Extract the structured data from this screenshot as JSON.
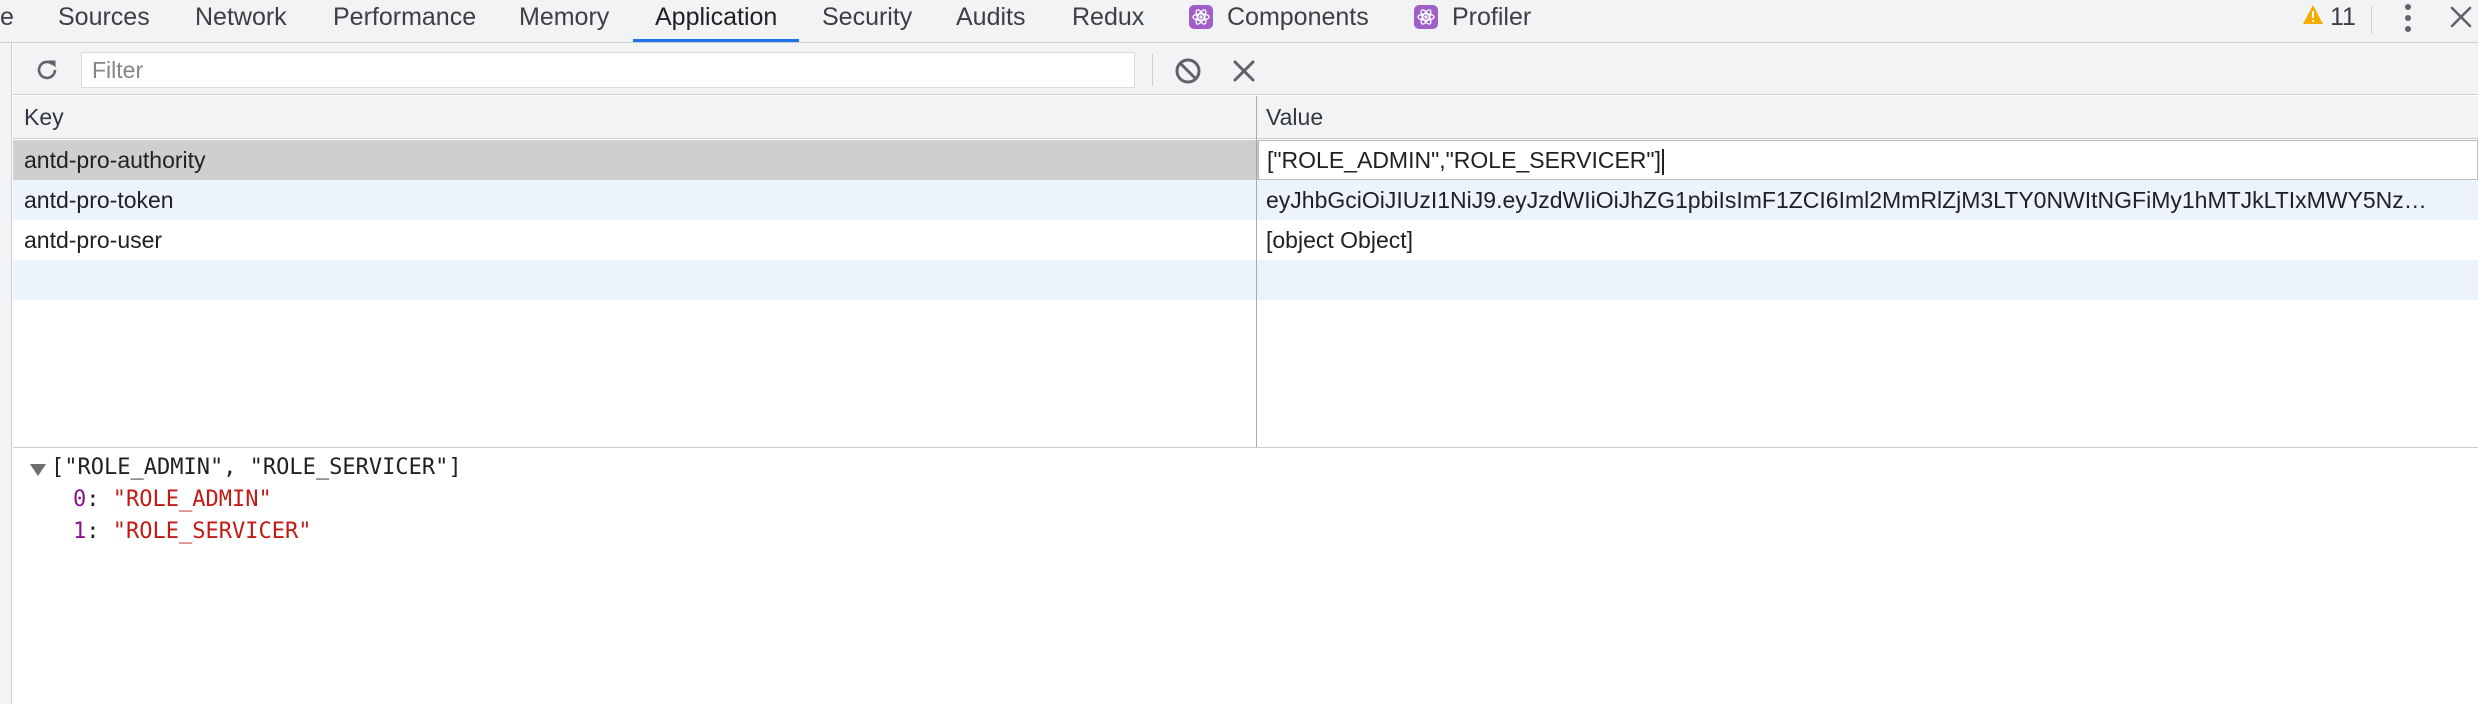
{
  "tabs": [
    {
      "label": "e"
    },
    {
      "label": "Sources"
    },
    {
      "label": "Network"
    },
    {
      "label": "Performance"
    },
    {
      "label": "Memory"
    },
    {
      "label": "Application"
    },
    {
      "label": "Security"
    },
    {
      "label": "Audits"
    },
    {
      "label": "Redux"
    },
    {
      "label": "Components"
    },
    {
      "label": "Profiler"
    }
  ],
  "warnings": {
    "count": "11"
  },
  "toolbar": {
    "filter_placeholder": "Filter",
    "filter_value": ""
  },
  "table": {
    "headers": [
      "Key",
      "Value"
    ],
    "rows": [
      {
        "key": "antd-pro-authority",
        "value": "[\"ROLE_ADMIN\",\"ROLE_SERVICER\"]"
      },
      {
        "key": "antd-pro-token",
        "value": "eyJhbGciOiJIUzI1NiJ9.eyJzdWIiOiJhZG1pbiIsImF1ZCI6Iml2MmRlZjM3LTY0NWItNGFiMy1hMTJkLTIxMWY5Nz…"
      },
      {
        "key": "antd-pro-user",
        "value": "[object Object]"
      }
    ]
  },
  "preview": {
    "summary": "[\"ROLE_ADMIN\", \"ROLE_SERVICER\"]",
    "items": [
      {
        "index": "0",
        "value": "ROLE_ADMIN"
      },
      {
        "index": "1",
        "value": "ROLE_SERVICER"
      }
    ]
  },
  "colors": {
    "accent": "#1a73e8",
    "selected_row": "#cfcfcf",
    "striped_row": "#edf3fd",
    "string": "#c41a16",
    "index": "#881391",
    "react_badge": "#a05fc7",
    "warning": "#f9ab00"
  },
  "icons": [
    "refresh-icon",
    "block-icon",
    "clear-icon",
    "react-icon",
    "warning-icon",
    "more-icon",
    "close-icon"
  ]
}
